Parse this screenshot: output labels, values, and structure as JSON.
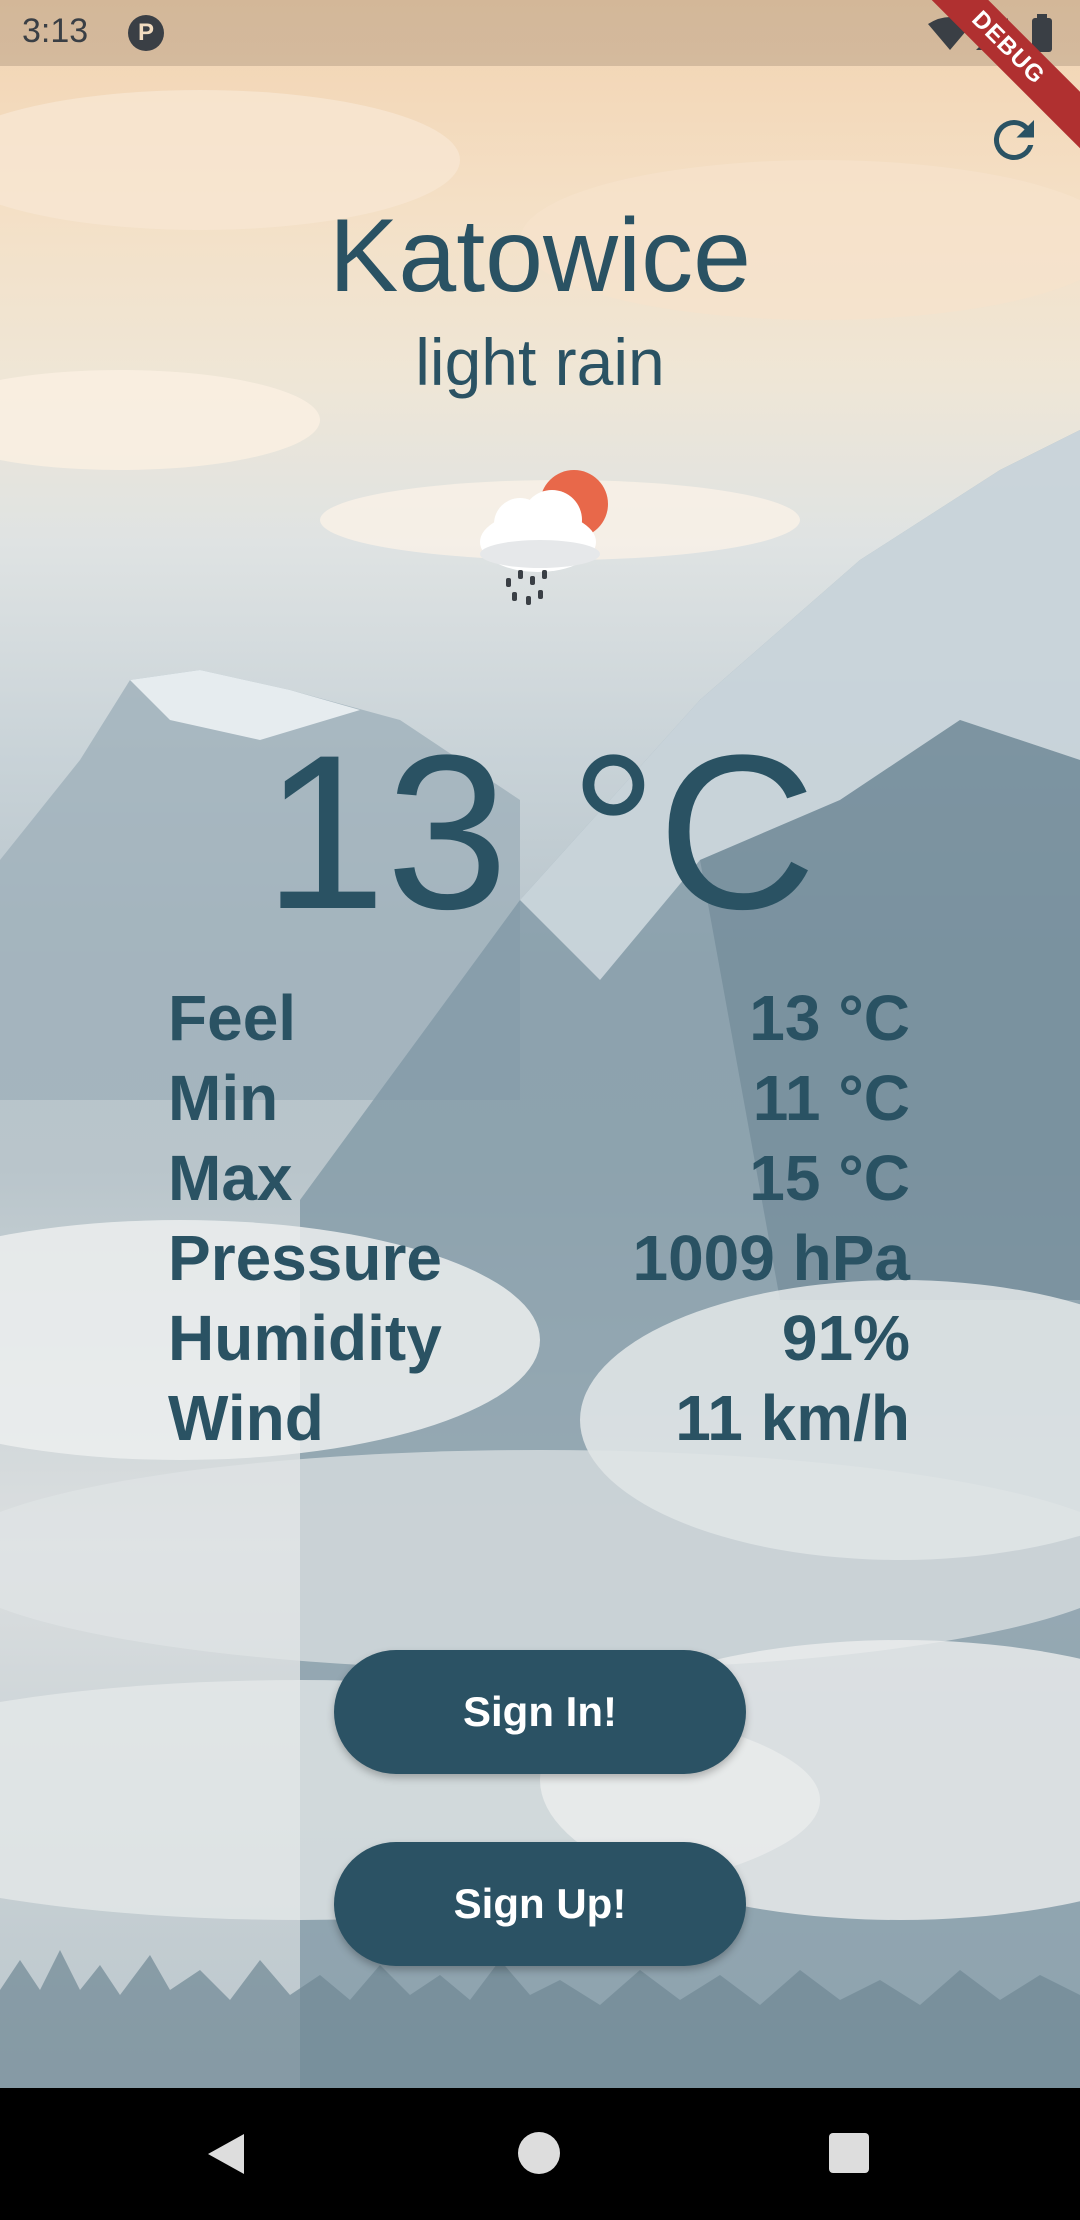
{
  "status_bar": {
    "time": "3:13",
    "debug_label": "DEBUG"
  },
  "weather": {
    "city": "Katowice",
    "description": "light rain",
    "temperature": "13 °C",
    "icon": "cloud-rain-sun-icon"
  },
  "stats": [
    {
      "label": "Feel",
      "value": "13 °C"
    },
    {
      "label": "Min",
      "value": "11 °C"
    },
    {
      "label": "Max",
      "value": "15 °C"
    },
    {
      "label": "Pressure",
      "value": "1009 hPa"
    },
    {
      "label": "Humidity",
      "value": "91%"
    },
    {
      "label": "Wind",
      "value": "11 km/h"
    }
  ],
  "buttons": {
    "sign_in": "Sign In!",
    "sign_up": "Sign Up!"
  },
  "colors": {
    "text_primary": "#2a5263",
    "button_bg": "#2b5264",
    "button_text": "#ffffff",
    "sun": "#e8684a"
  },
  "icons": {
    "refresh": "refresh-icon",
    "back": "back-triangle-icon",
    "home": "home-circle-icon",
    "recents": "recents-square-icon"
  }
}
